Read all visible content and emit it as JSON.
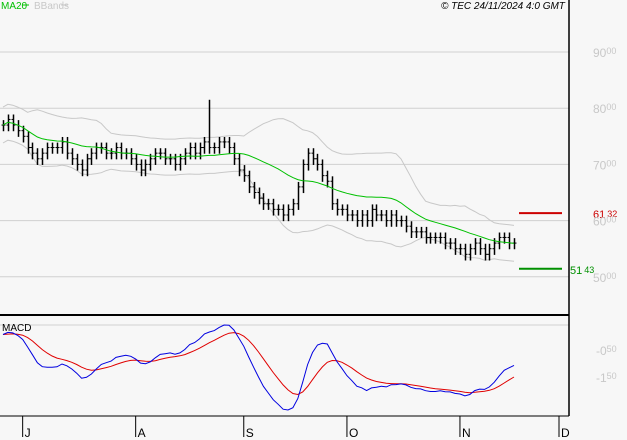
{
  "legend": {
    "ma_label": "MA20",
    "bbands_label": "BBands"
  },
  "copyright": "© TEC 24/11/2024 4:0 GMT",
  "colors": {
    "ma": "#00c000",
    "bbands": "#c8c8c8",
    "bars": "#000000",
    "macd": "#0000e0",
    "signal": "#e00000",
    "resistance": "#cc0000",
    "support": "#009000"
  },
  "chart_data": [
    {
      "type": "ohlc",
      "title": "Price",
      "ylim": [
        45,
        95
      ],
      "yticks": [
        {
          "int": "90",
          "dec": "00",
          "value": 90
        },
        {
          "int": "80",
          "dec": "00",
          "value": 80
        },
        {
          "int": "70",
          "dec": "00",
          "value": 70
        },
        {
          "int": "60",
          "dec": "00",
          "value": 60
        },
        {
          "int": "50",
          "dec": "00",
          "value": 50
        }
      ],
      "closes": [
        77,
        78,
        77,
        76,
        75,
        73,
        72,
        71,
        72,
        73,
        73,
        73,
        74,
        72,
        71,
        70,
        69,
        71,
        72,
        73,
        73,
        72,
        72,
        73,
        72,
        72,
        71,
        70,
        69,
        70,
        71,
        72,
        72,
        71,
        71,
        70,
        71,
        72,
        73,
        72,
        73,
        74,
        73,
        73,
        74,
        74,
        73,
        71,
        69,
        68,
        66,
        65,
        64,
        63,
        63,
        62,
        62,
        61,
        62,
        63,
        66,
        70,
        72,
        71,
        70,
        68,
        67,
        63,
        62,
        62,
        61,
        61,
        60,
        61,
        60,
        62,
        61,
        61,
        60,
        61,
        60,
        60,
        59,
        58,
        58,
        58,
        57,
        57,
        57,
        57,
        56,
        56,
        55,
        55,
        54,
        55,
        56,
        55,
        54,
        55,
        56,
        57,
        57,
        56,
        56
      ],
      "bar_range": 2.2,
      "high_overrides": {
        "42": 81.5
      },
      "indicators": [
        "MA20",
        "BBands(20,2)"
      ],
      "levels": [
        {
          "name": "resistance",
          "value": 61.32,
          "int": "61",
          "dec": "32"
        },
        {
          "name": "support",
          "value": 51.43,
          "int": "51",
          "dec": "43"
        }
      ],
      "xticks": [
        "J",
        "A",
        "S",
        "O",
        "N",
        "D"
      ],
      "xtick_bar_index": [
        4,
        27,
        49,
        70,
        93,
        116
      ]
    },
    {
      "type": "line",
      "title": "MACD",
      "series": [
        {
          "name": "MACD"
        },
        {
          "name": "Signal"
        }
      ],
      "yticks": [
        {
          "int": "-0",
          "dec": "50",
          "value": -0.5
        },
        {
          "int": "-1",
          "dec": "50",
          "value": -1.5
        }
      ]
    }
  ]
}
